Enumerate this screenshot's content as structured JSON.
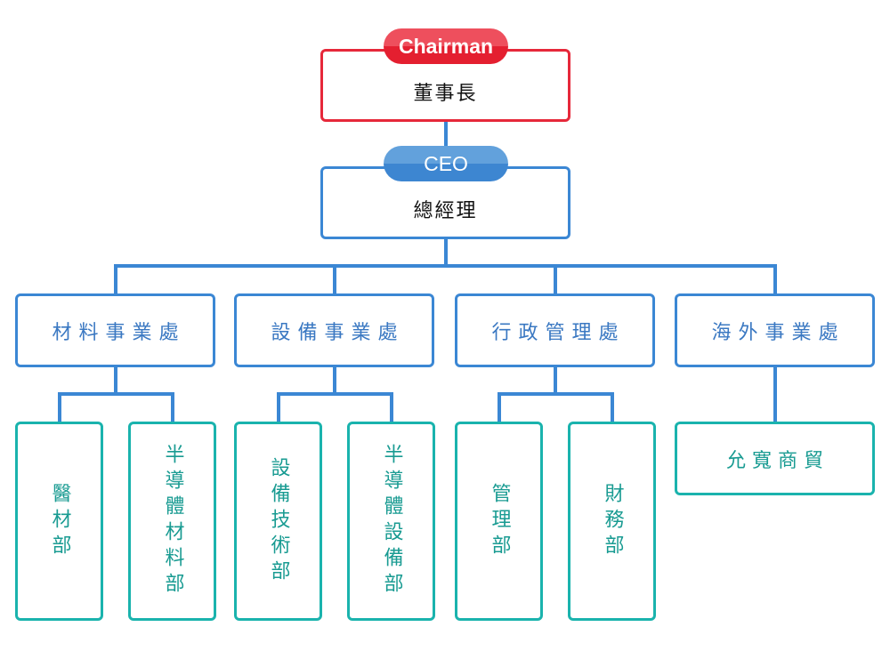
{
  "colors": {
    "chairman": "#e6283a",
    "connector": "#3b87d4",
    "division": "#3a78c2",
    "department": "#1ab3ad"
  },
  "chairman": {
    "badge": "Chairman",
    "title": "董事長"
  },
  "ceo": {
    "badge": "CEO",
    "title": "總經理"
  },
  "divisions": [
    {
      "name": "材料事業處",
      "departments": [
        "醫材部",
        "半導體材料部"
      ]
    },
    {
      "name": "設備事業處",
      "departments": [
        "設備技術部",
        "半導體設備部"
      ]
    },
    {
      "name": "行政管理處",
      "departments": [
        "管理部",
        "財務部"
      ]
    },
    {
      "name": "海外事業處",
      "departments": [
        "允寬商貿"
      ]
    }
  ]
}
